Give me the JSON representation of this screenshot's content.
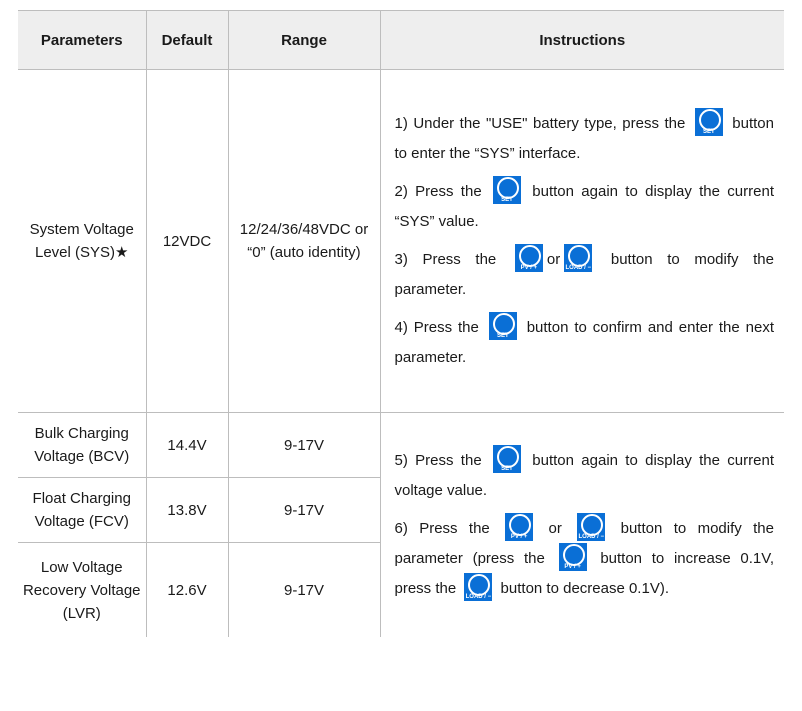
{
  "headers": [
    "Parameters",
    "Default",
    "Range",
    "Instructions"
  ],
  "rows": {
    "sys": {
      "param": "System Voltage Level (SYS)★",
      "default": "12VDC",
      "range": "12/24/36/48VDC or “0” (auto identity)"
    },
    "bcv": {
      "param": "Bulk Charging Voltage (BCV)",
      "default": "14.4V",
      "range": "9-17V"
    },
    "fcv": {
      "param": "Float Charging Voltage (FCV)",
      "default": "13.8V",
      "range": "9-17V"
    },
    "lvr": {
      "param": "Low Voltage Recovery Voltage (LVR)",
      "default": "12.6V",
      "range": "9-17V"
    }
  },
  "buttons": {
    "set": "SET",
    "pv": "PV / +",
    "load": "LOAD / −",
    "color": "#0a6fd6"
  },
  "steps": {
    "s1a": "1) Under the \"USE\" battery type, press the",
    "s1b": "button to enter the “SYS” interface.",
    "s2a": "2) Press the",
    "s2b": "button again to display the current “SYS” value.",
    "s3a": "3) Press the",
    "s3or": "or",
    "s3b": "button to modify the parameter.",
    "s4a": "4) Press the",
    "s4b": "button to confirm and enter the next parameter.",
    "s5a": "5) Press the",
    "s5b": "button again to display the current voltage value.",
    "s6a": "6) Press the",
    "s6or": "or",
    "s6b": "button to modify the parameter (press the",
    "s6c": "button to increase 0.1V, press the",
    "s6d": "button to decrease 0.1V)."
  }
}
